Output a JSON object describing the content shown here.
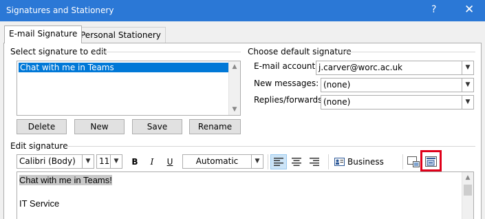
{
  "window": {
    "title": "Signatures and Stationery",
    "help_label": "?",
    "close_label": "✕"
  },
  "tabs": [
    {
      "label": "E-mail Signature",
      "active": true
    },
    {
      "label": "Personal Stationery",
      "active": false
    }
  ],
  "select_section": {
    "label": "Select signature to edit",
    "signatures": [
      "Chat with me in Teams"
    ],
    "selected": "Chat with me in Teams"
  },
  "signature_buttons": {
    "delete": "Delete",
    "new": "New",
    "save": "Save",
    "rename": "Rename"
  },
  "default_section": {
    "label": "Choose default signature",
    "email_account_label": "E-mail account:",
    "email_account_value": "j.carver@worc.ac.uk",
    "new_messages_label": "New messages:",
    "new_messages_value": "(none)",
    "replies_label": "Replies/forwards:",
    "replies_value": "(none)"
  },
  "edit_section": {
    "label": "Edit signature"
  },
  "toolbar": {
    "font_name": "Calibri (Body)",
    "font_size": "11",
    "bold": "B",
    "italic": "I",
    "underline": "U",
    "color": "Automatic",
    "business_card": "Business Card",
    "icons": [
      "align-left-icon",
      "align-center-icon",
      "align-right-icon",
      "business-card-icon",
      "insert-picture-icon",
      "insert-hyperlink-icon"
    ]
  },
  "editor": {
    "lines": [
      "Chat with me in Teams!",
      "IT Service"
    ]
  },
  "colors": {
    "titlebar": "#2b78d6",
    "selection": "#0078d7",
    "highlight_box": "#e0001a"
  }
}
